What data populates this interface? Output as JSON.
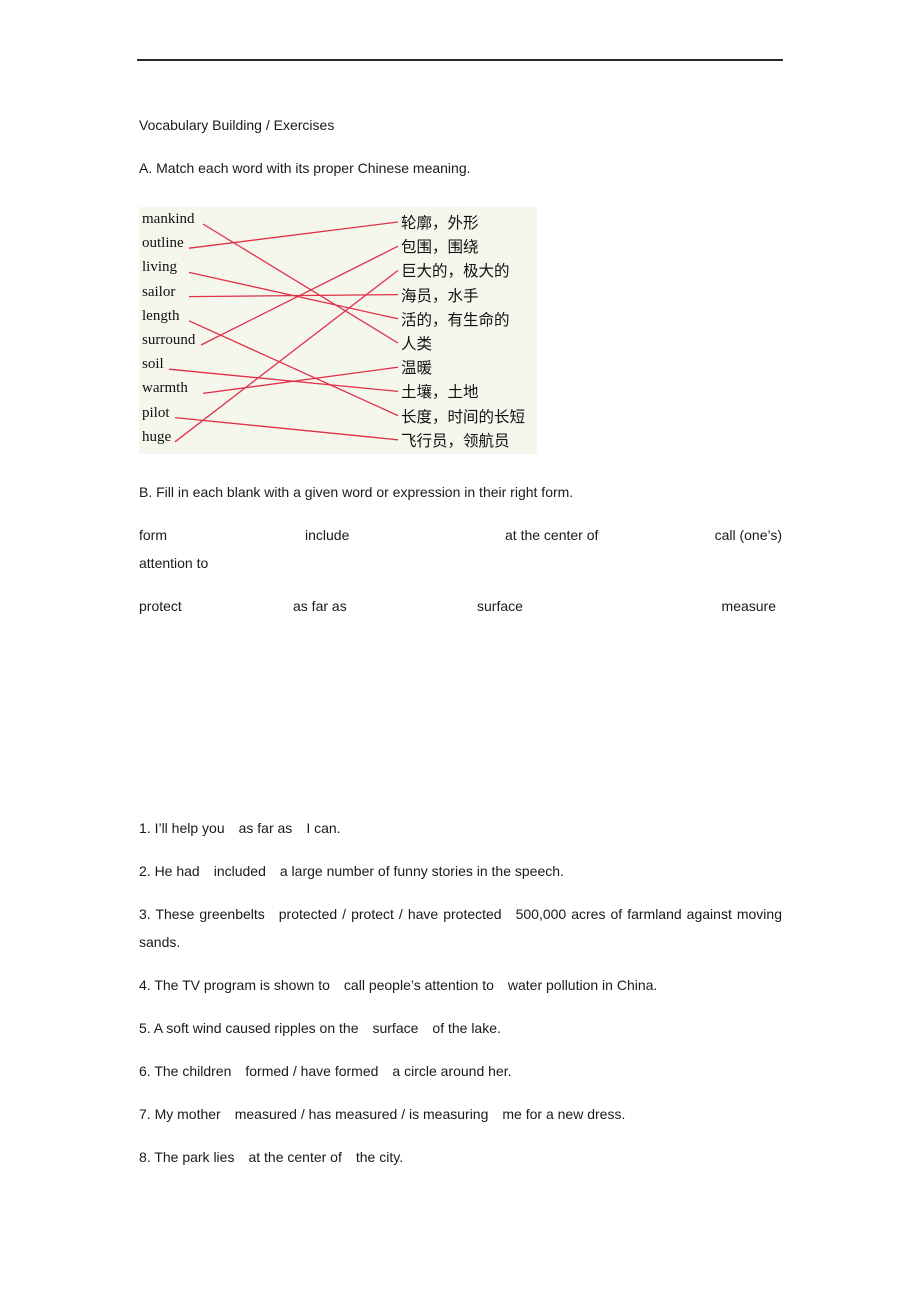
{
  "document": {
    "heading": "Vocabulary Building / Exercises",
    "section_a": {
      "instruction": "A. Match each word with its proper Chinese meaning.",
      "english_words": [
        "mankind",
        "outline",
        "living",
        "sailor",
        "length",
        "surround",
        "soil",
        "warmth",
        "pilot",
        "huge"
      ],
      "chinese_meanings": [
        "轮廓，外形",
        "包围，围绕",
        "巨大的，极大的",
        "海员，水手",
        "活的，有生命的",
        "人类",
        "温暖",
        "土壤，土地",
        "长度，时间的长短",
        "飞行员，领航员"
      ],
      "matches": [
        {
          "english": "mankind",
          "chinese": "人类"
        },
        {
          "english": "outline",
          "chinese": "轮廓，外形"
        },
        {
          "english": "living",
          "chinese": "活的，有生命的"
        },
        {
          "english": "sailor",
          "chinese": "海员，水手"
        },
        {
          "english": "length",
          "chinese": "长度，时间的长短"
        },
        {
          "english": "surround",
          "chinese": "包围，围绕"
        },
        {
          "english": "soil",
          "chinese": "土壤，土地"
        },
        {
          "english": "warmth",
          "chinese": "温暖"
        },
        {
          "english": "pilot",
          "chinese": "飞行员，领航员"
        },
        {
          "english": "huge",
          "chinese": "巨大的，极大的"
        }
      ],
      "line_color": "#e0304a",
      "background_color": "#f5f6ec"
    },
    "section_b": {
      "instruction": "B. Fill in each blank with a given word or expression in their right form.",
      "word_bank_row1": [
        "form",
        "include",
        "at the center of",
        "call (one’s)"
      ],
      "word_bank_row1_wrap": "attention to",
      "word_bank_row2": [
        "protect",
        "as far as",
        "surface",
        "measure"
      ],
      "sentences": [
        {
          "before": "1. I’ll help you",
          "answer": "as far as",
          "after": "I can."
        },
        {
          "before": "2. He had",
          "answer": "included",
          "after": "a large number of funny stories in the speech."
        },
        {
          "before": "3. These greenbelts",
          "answer": "protected / protect / have protected",
          "after": "500,000 acres of farmland against moving sands."
        },
        {
          "before": "4. The TV program is shown to",
          "answer": "call people’s attention to",
          "after": "water pollution in China."
        },
        {
          "before": "5. A soft wind caused ripples on the",
          "answer": "surface",
          "after": "of the lake."
        },
        {
          "before": "6. The children",
          "answer": "formed / have formed",
          "after": "a circle around her."
        },
        {
          "before": "7. My mother",
          "answer": "measured / has measured / is measuring",
          "after": "me for a new dress."
        },
        {
          "before": "8. The park lies",
          "answer": "at the center of",
          "after": "the city."
        }
      ]
    }
  }
}
